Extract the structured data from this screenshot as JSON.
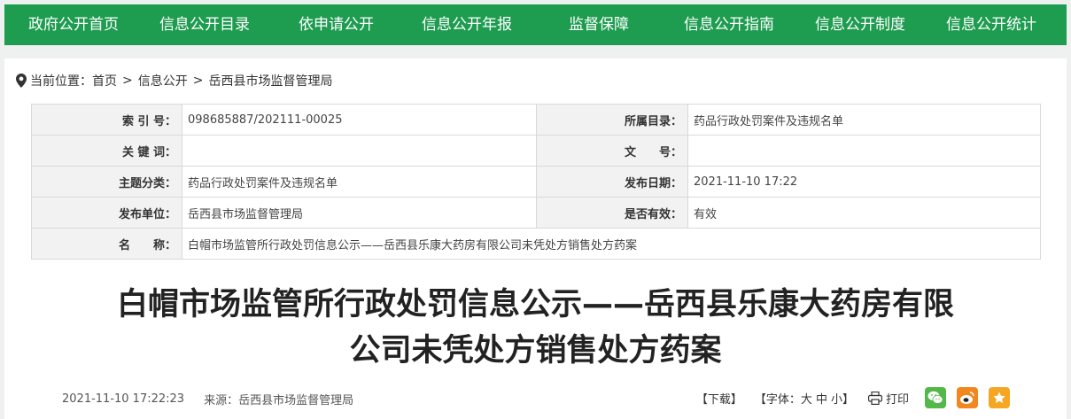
{
  "nav": {
    "items": [
      "政府公开首页",
      "信息公开目录",
      "依申请公开",
      "信息公开年报",
      "监督保障",
      "信息公开指南",
      "信息公开制度",
      "信息公开统计"
    ]
  },
  "breadcrumb": {
    "label": "当前位置：",
    "items": [
      "首页",
      "信息公开",
      "岳西县市场监督管理局"
    ],
    "separator": ">"
  },
  "meta": {
    "index_no_label": "索 引 号：",
    "index_no": "098685887/202111-00025",
    "category_label": "所属目录：",
    "category": "药品行政处罚案件及违规名单",
    "keywords_label": "关 键 词：",
    "keywords": "",
    "doc_no_label": "文　　号：",
    "doc_no": "",
    "topic_label": "主题分类：",
    "topic": "药品行政处罚案件及违规名单",
    "pub_date_label": "发布日期：",
    "pub_date": "2021-11-10 17:22",
    "publisher_label": "发布单位：",
    "publisher": "岳西县市场监督管理局",
    "valid_label": "是否有效：",
    "valid": "有效",
    "name_label": "名　　称：",
    "name": "白帽市场监管所行政处罚信息公示——岳西县乐康大药房有限公司未凭处方销售处方药案"
  },
  "article": {
    "title_line1": "白帽市场监管所行政处罚信息公示——岳西县乐康大药房有限",
    "title_line2": "公司未凭处方销售处方药案",
    "datetime": "2021-11-10 17:22:23",
    "source": "来源：岳西县市场监督管理局",
    "download": "【下载】",
    "font_label": "【字体：",
    "font_large": "大",
    "font_medium": "中",
    "font_small": "小",
    "font_close": "】",
    "print": "打印"
  },
  "colors": {
    "nav_bg": "#1e9c50",
    "wechat": "#52b847",
    "weibo": "#f2861f",
    "favorite": "#f5a623"
  }
}
